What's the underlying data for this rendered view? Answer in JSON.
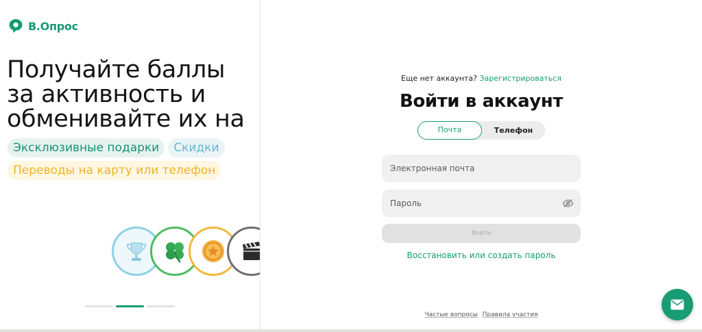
{
  "brand": {
    "name": "В.Опрос",
    "accent": "#179c73"
  },
  "promo": {
    "headline": [
      "Получайте баллы",
      "за активность и",
      "обменивайте их на"
    ],
    "chips": [
      [
        "Эксклюзивные подарки",
        "Скидки"
      ],
      [
        "Переводы на карту или телефон"
      ]
    ],
    "carousel_icons": [
      "trophy-icon",
      "clover-icon",
      "coin-icon",
      "clapperboard-icon"
    ],
    "carousel_pages": 3,
    "carousel_active_index": 1
  },
  "login": {
    "no_account_text": "Еще нет аккаунта?",
    "signup_link": "Зарегистрироваться",
    "title": "Войти в аккаунт",
    "tabs": {
      "email": "Почта",
      "phone": "Телефон",
      "selected": "email"
    },
    "email_placeholder": "Электронная почта",
    "password_placeholder": "Пароль",
    "submit_label": "Войти",
    "restore_link": "Восстановить или создать пароль"
  },
  "footer": {
    "faq": "Частые вопросы",
    "rules": "Правила участия"
  },
  "chat_button": {
    "icon": "mail-icon"
  }
}
